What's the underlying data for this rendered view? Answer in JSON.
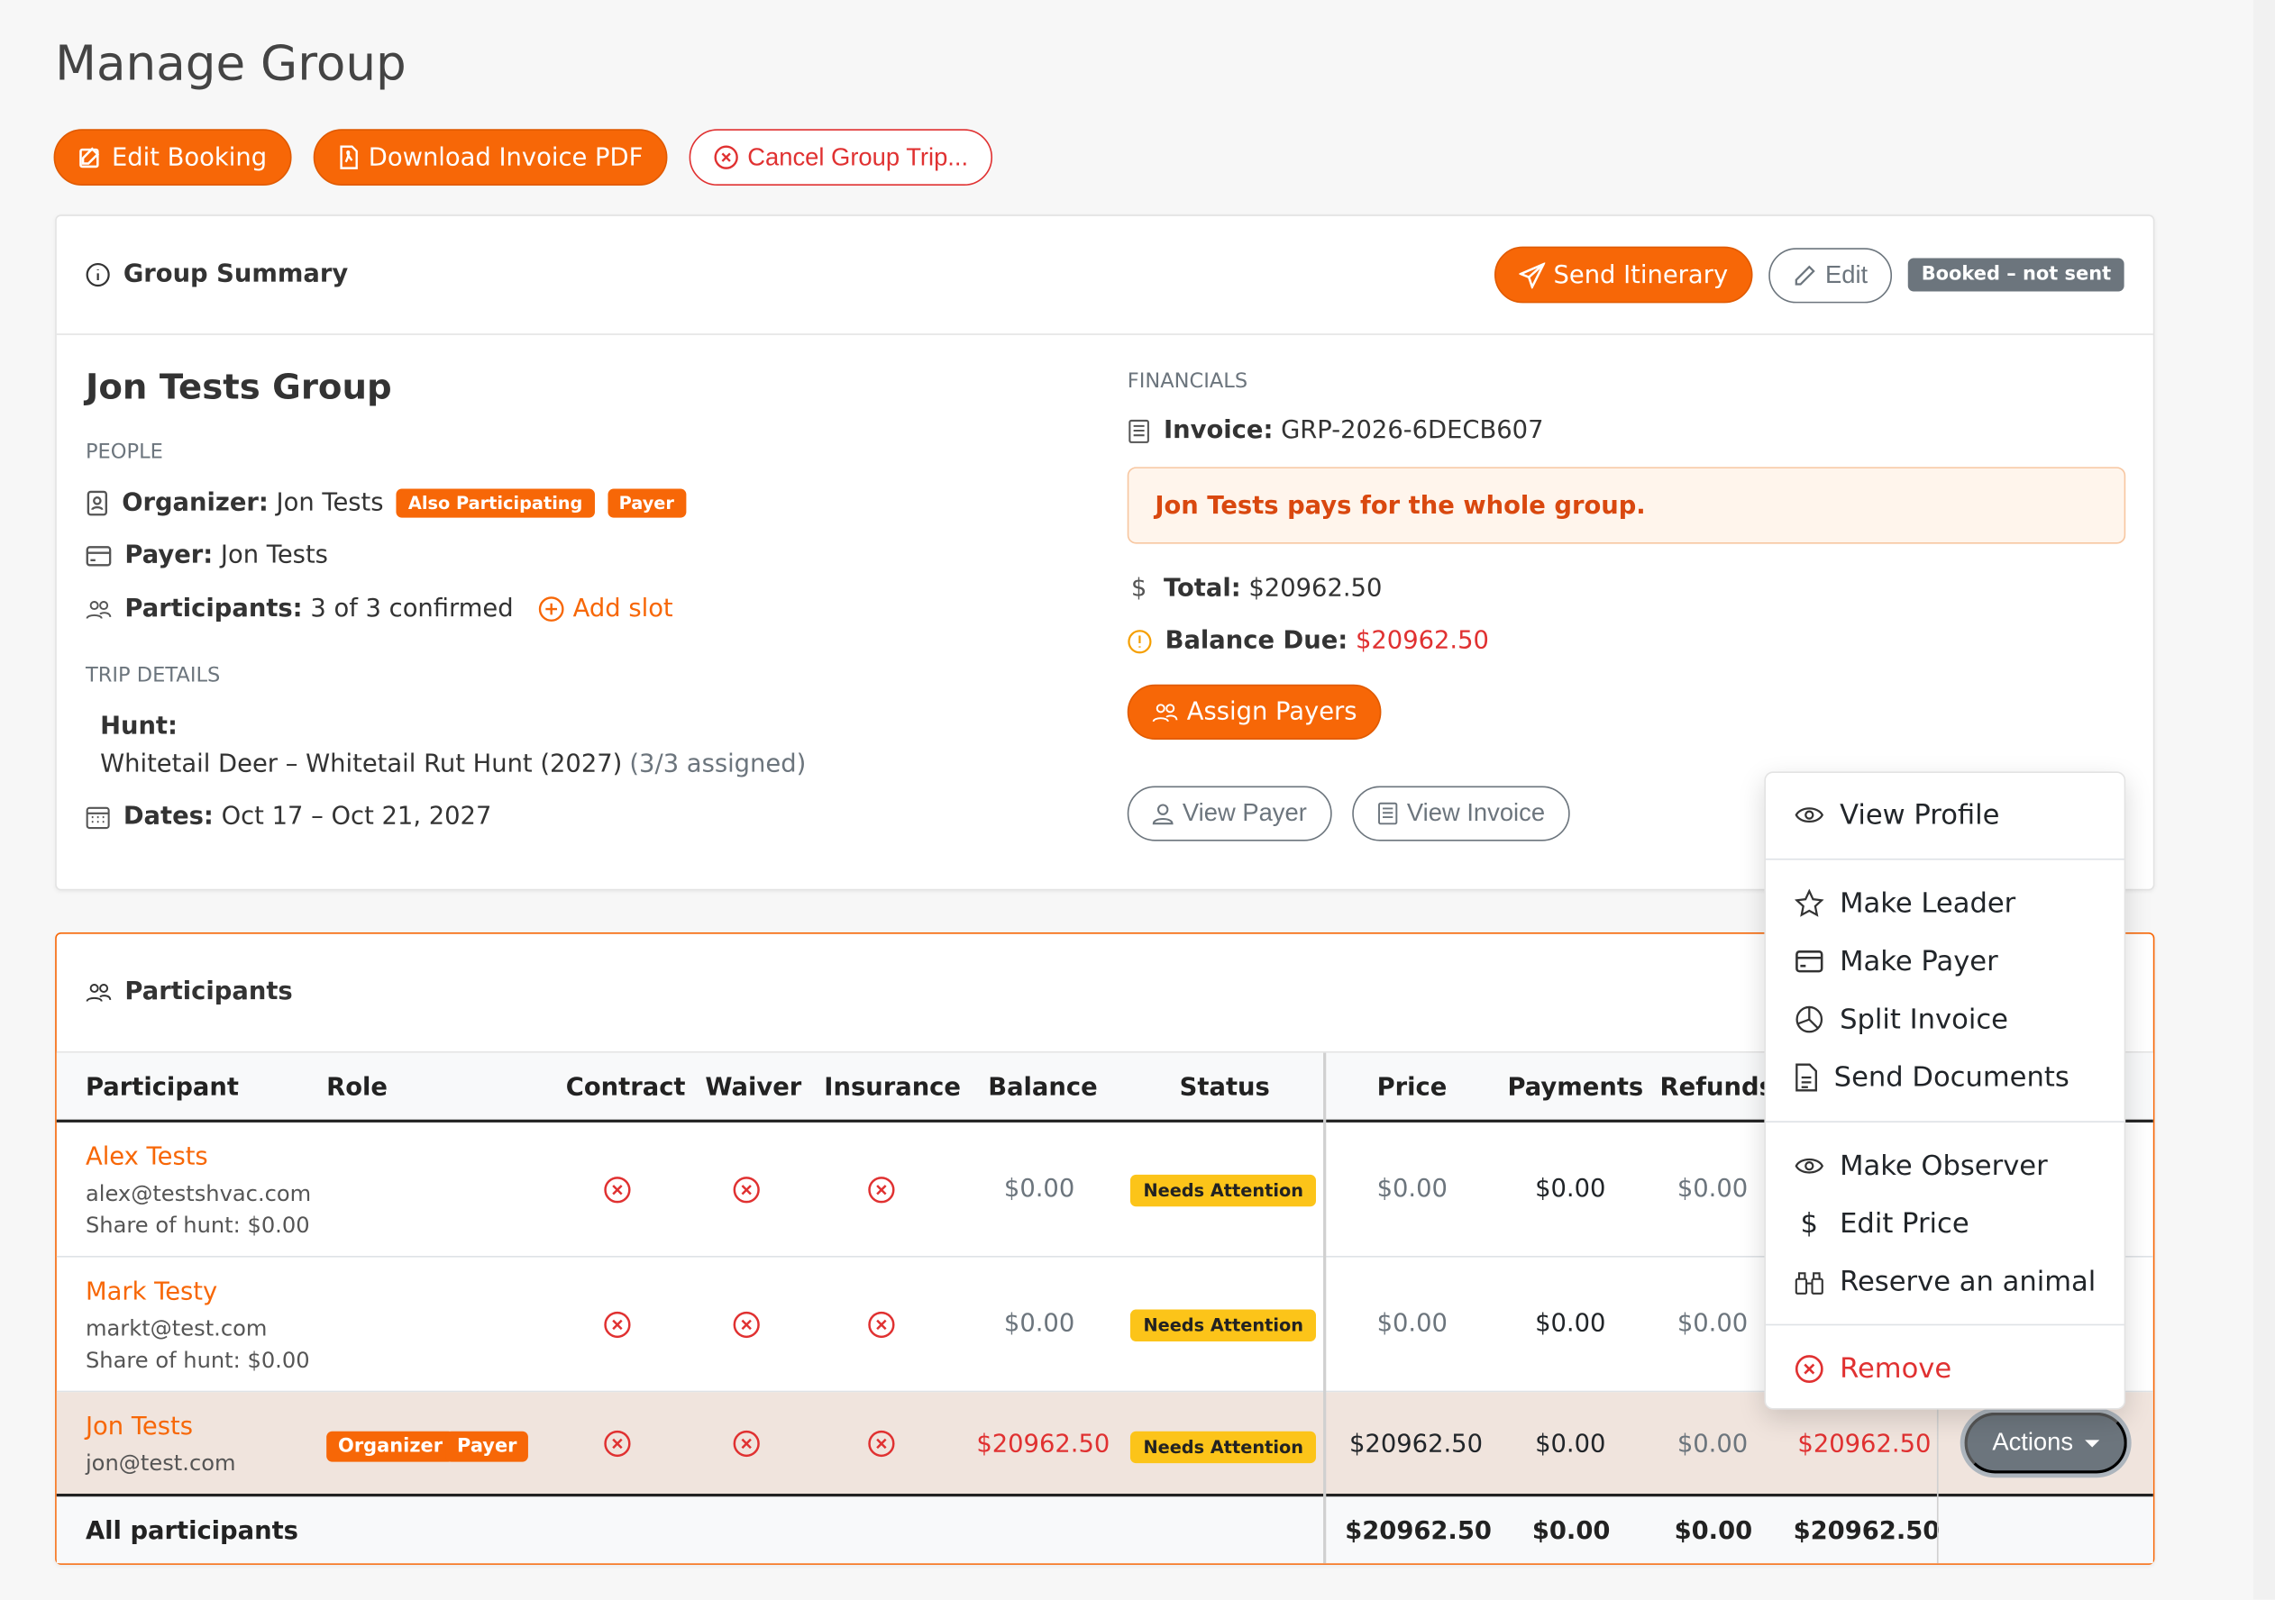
{
  "page": {
    "title": "Manage Group"
  },
  "top_actions": {
    "edit_booking": "Edit Booking",
    "download_invoice": "Download Invoice PDF",
    "cancel_trip": "Cancel Group Trip..."
  },
  "summary": {
    "header": "Group Summary",
    "send_itinerary": "Send Itinerary",
    "edit": "Edit",
    "status_badge": "Booked – not sent",
    "group_name": "Jon Tests Group",
    "people_label": "PEOPLE",
    "organizer_label": "Organizer:",
    "organizer_value": "Jon Tests",
    "organizer_badges": [
      "Also Participating",
      "Payer"
    ],
    "payer_label": "Payer:",
    "payer_value": "Jon Tests",
    "participants_label": "Participants:",
    "participants_value": "3 of 3 confirmed",
    "add_slot": "Add slot",
    "trip_details_label": "TRIP DETAILS",
    "hunt_label": "Hunt:",
    "hunt_value": "Whitetail Deer – Whitetail Rut Hunt (2027)",
    "hunt_assigned": "(3/3 assigned)",
    "dates_label": "Dates:",
    "dates_value": "Oct 17 – Oct 21, 2027",
    "financials_label": "FINANCIALS",
    "invoice_label": "Invoice:",
    "invoice_value": "GRP-2026-6DECB607",
    "pays_notice": "Jon Tests pays for the whole group.",
    "total_label": "Total:",
    "total_value": "$20962.50",
    "balance_label": "Balance Due:",
    "balance_value": "$20962.50",
    "assign_payers": "Assign Payers",
    "view_payer": "View Payer",
    "view_invoice": "View Invoice"
  },
  "participants": {
    "header": "Participants",
    "columns": [
      "Participant",
      "Role",
      "Contract",
      "Waiver",
      "Insurance",
      "Balance",
      "Status",
      "Price",
      "Payments",
      "Refunds"
    ],
    "rows": [
      {
        "name": "Alex Tests",
        "email": "alex@testshvac.com",
        "share": "Share of hunt: $0.00",
        "balance": "$0.00",
        "status": "Needs Attention",
        "price": "$0.00",
        "payments": "$0.00",
        "refunds": "$0.00"
      },
      {
        "name": "Mark Testy",
        "email": "markt@test.com",
        "share": "Share of hunt: $0.00",
        "balance": "$0.00",
        "status": "Needs Attention",
        "price": "$0.00",
        "payments": "$0.00",
        "refunds": "$0.00"
      },
      {
        "name": "Jon Tests",
        "email": "jon@test.com",
        "roles": [
          "Organizer",
          "Payer"
        ],
        "balance": "$20962.50",
        "status": "Needs Attention",
        "price": "$20962.50",
        "payments": "$0.00",
        "refunds": "$0.00",
        "due": "$20962.50"
      }
    ],
    "footer": {
      "label": "All participants",
      "price": "$20962.50",
      "payments": "$0.00",
      "refunds": "$0.00",
      "due": "$20962.50"
    },
    "actions_button": "Actions"
  },
  "dropdown": {
    "items": [
      "View Profile",
      "Make Leader",
      "Make Payer",
      "Split Invoice",
      "Send Documents",
      "Make Observer",
      "Edit Price",
      "Reserve an animal",
      "Remove"
    ]
  },
  "colors": {
    "accent": "#f76707",
    "danger": "#e03131",
    "warning": "#fcc419",
    "secondary": "#6c757d"
  }
}
